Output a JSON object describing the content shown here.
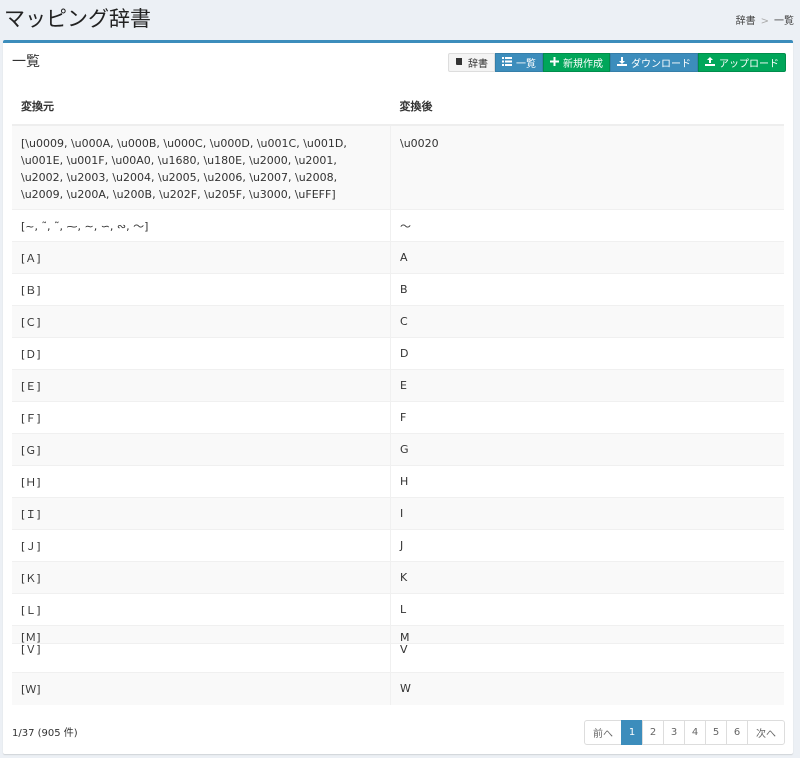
{
  "header": {
    "title": "マッピング辞書",
    "breadcrumb": [
      "辞書",
      "一覧"
    ],
    "breadcrumb_sep": ">"
  },
  "box": {
    "title": "一覧"
  },
  "toolbar": {
    "dict": "辞書",
    "list": "一覧",
    "create": "新規作成",
    "download": "ダウンロード",
    "upload": "アップロード"
  },
  "table": {
    "headers": [
      "変換元",
      "変換後"
    ],
    "rows": [
      {
        "src": "[\\u0009, \\u000A, \\u000B, \\u000C, \\u000D, \\u001C, \\u001D, \\u001E, \\u001F, \\u00A0, \\u1680, \\u180E, \\u2000, \\u2001, \\u2002, \\u2003, \\u2004, \\u2005, \\u2006, \\u2007, \\u2008, \\u2009, \\u200A, \\u200B, \\u202F, \\u205F, \\u3000, \\uFEFF]",
        "dst": "\\u0020"
      },
      {
        "src": "[~, ˜, ˜, ⁓, ∼, ∽, ∾, 〜]",
        "dst": "〜"
      },
      {
        "src": "[Ａ]",
        "dst": "A"
      },
      {
        "src": "[Ｂ]",
        "dst": "B"
      },
      {
        "src": "[Ｃ]",
        "dst": "C"
      },
      {
        "src": "[Ｄ]",
        "dst": "D"
      },
      {
        "src": "[Ｅ]",
        "dst": "E"
      },
      {
        "src": "[Ｆ]",
        "dst": "F"
      },
      {
        "src": "[Ｇ]",
        "dst": "G"
      },
      {
        "src": "[Ｈ]",
        "dst": "H"
      },
      {
        "src": "[Ｉ]",
        "dst": "I"
      },
      {
        "src": "[Ｊ]",
        "dst": "J"
      },
      {
        "src": "[Ｋ]",
        "dst": "K"
      },
      {
        "src": "[Ｌ]",
        "dst": "L"
      },
      {
        "src": "[Ｍ]",
        "dst": "M"
      },
      {
        "src": "[Ｖ]",
        "dst": "V"
      },
      {
        "src": "[Ｗ]",
        "dst": "W"
      }
    ]
  },
  "footer": {
    "info": "1/37 (905 件)"
  },
  "pagination": {
    "prev": "前へ",
    "pages": [
      "1",
      "2",
      "3",
      "4",
      "5",
      "6"
    ],
    "next": "次へ",
    "current": "1"
  },
  "icons": {
    "dict": "book-icon",
    "list": "list-icon",
    "create": "plus-icon",
    "download": "download-icon",
    "upload": "upload-icon"
  },
  "colors": {
    "primary": "#3c8dbc",
    "success": "#00a65a"
  }
}
